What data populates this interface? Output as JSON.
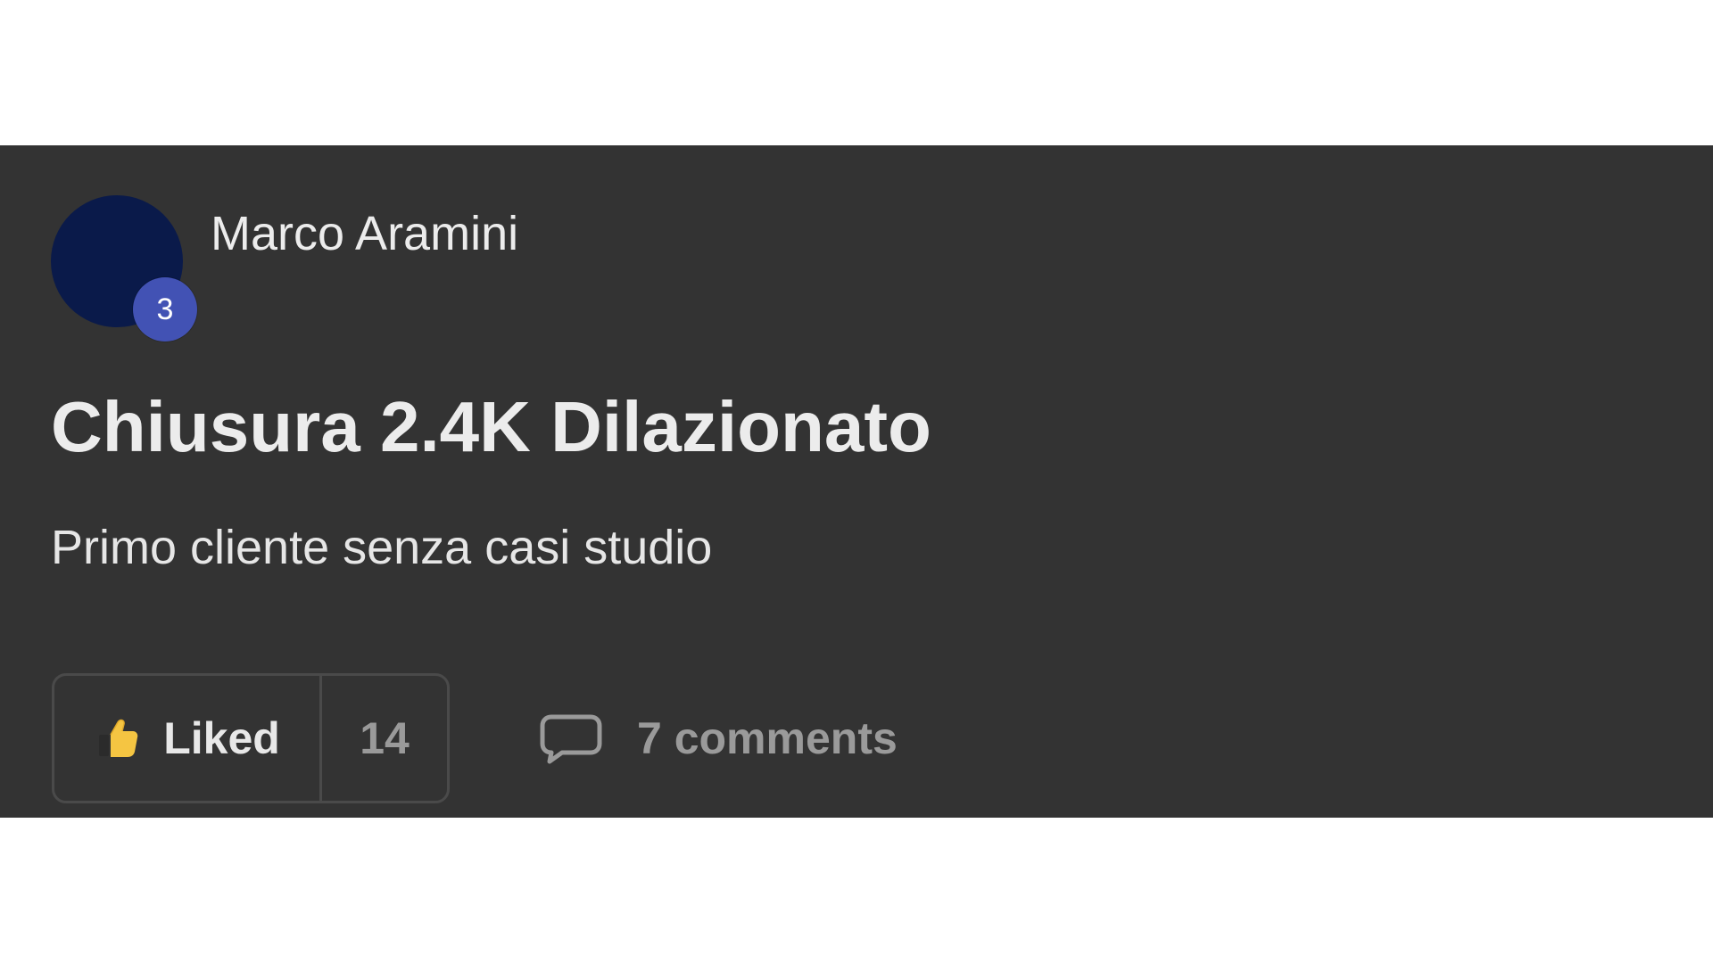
{
  "post": {
    "author": {
      "name": "Marco Aramini",
      "level": "3",
      "avatar_color": "#0a1a4a",
      "badge_color": "#4252b4"
    },
    "title": "Chiusura 2.4K Dilazionato",
    "body": "Primo cliente senza casi studio",
    "actions": {
      "like_label": "Liked",
      "like_icon": "thumbs-up-icon",
      "like_count": "14",
      "comments_label": "7 comments",
      "comments_icon": "speech-bubble-icon"
    }
  },
  "colors": {
    "card_background": "#333333",
    "page_background": "#ffffff",
    "primary_text": "#ececec",
    "muted_text": "#9a9a9a",
    "border": "#4a4a4a",
    "thumb_yellow": "#f5c542"
  }
}
